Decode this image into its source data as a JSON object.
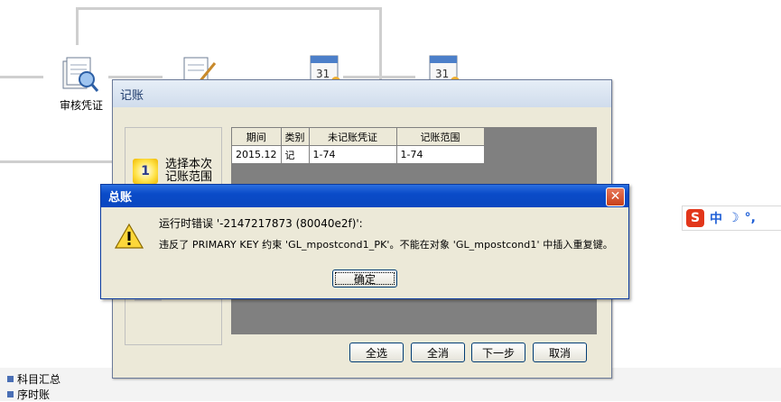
{
  "flow": {
    "audit_label": "审核凭证"
  },
  "left_nav": {
    "items": [
      {
        "label": "科目汇总"
      },
      {
        "label": "序时账"
      }
    ]
  },
  "window": {
    "title": "记账",
    "step": {
      "number": "1",
      "label": "选择本次记账范围"
    },
    "table": {
      "columns": [
        "期间",
        "类别",
        "未记账凭证",
        "记账范围"
      ],
      "rows": [
        [
          "2015.12",
          "记",
          "1-74",
          "1-74"
        ]
      ]
    },
    "buttons": {
      "select_all": "全选",
      "clear_all": "全消",
      "next": "下一步",
      "cancel": "取消"
    }
  },
  "dialog": {
    "title": "总账",
    "line1": "运行时错误 '-2147217873 (80040e2f)':",
    "line2": "违反了 PRIMARY KEY 约束 'GL_mpostcond1_PK'。不能在对象 'GL_mpostcond1' 中插入重复键。",
    "ok_label": "确定",
    "close_glyph": "✕"
  },
  "ime": {
    "logo": "S",
    "mode": "中",
    "moon": "☽",
    "punct": "°,"
  }
}
